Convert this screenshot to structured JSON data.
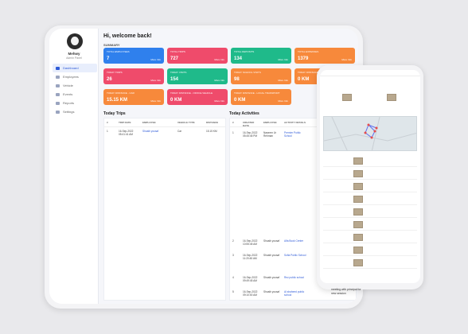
{
  "user": {
    "name": "Mehwy",
    "role": "Admin Panel"
  },
  "nav": [
    {
      "label": "Dashboard",
      "active": true
    },
    {
      "label": "Employees",
      "active": false
    },
    {
      "label": "Vehicle",
      "active": false
    },
    {
      "label": "Events",
      "active": false
    },
    {
      "label": "Reports",
      "active": false
    },
    {
      "label": "Settings",
      "active": false
    }
  ],
  "greeting": "Hi, welcome back!",
  "summary_label": "SUMMARY",
  "cards": [
    {
      "label": "TOTAL EMPLOYEES",
      "value": "7",
      "more": "More Info",
      "color": "#2f80ed"
    },
    {
      "label": "TOTAL TRIPS",
      "value": "727",
      "more": "More Info",
      "color": "#ef4b6b"
    },
    {
      "label": "TOTAL DEPOSITS",
      "value": "134",
      "more": "More Info",
      "color": "#1fba8a"
    },
    {
      "label": "TOTAL EXPENSES",
      "value": "1379",
      "more": "More Info",
      "color": "#f7893b"
    },
    {
      "label": "TODAY TRIPS",
      "value": "26",
      "more": "More Info",
      "color": "#ef4b6b"
    },
    {
      "label": "TODAY VISITS",
      "value": "154",
      "more": "More Info",
      "color": "#1fba8a"
    },
    {
      "label": "TODAY SCHOOL VISITS",
      "value": "98",
      "more": "More Info",
      "color": "#f7893b"
    },
    {
      "label": "TODAY DISTANCE",
      "value": "0 KM",
      "more": "More Info",
      "color": "#f7893b"
    },
    {
      "label": "TODAY Distance - Car",
      "value": "15.15 KM",
      "more": "More Info",
      "color": "#f7893b"
    },
    {
      "label": "TODAY Distance - Office Vehicle",
      "value": "0 KM",
      "more": "More Info",
      "color": "#ef4b6b"
    },
    {
      "label": "TODAY Distance - Local Transport",
      "value": "0 KM",
      "more": "More Info",
      "color": "#f7893b"
    }
  ],
  "trips": {
    "title": "Today Trips",
    "headers": [
      "#",
      "TRIP DATE",
      "EMPLOYEE",
      "VEHICLE TYPE",
      "DISTANCE"
    ],
    "rows": [
      [
        "1",
        "16-Sep-2022 05:41:41 AM",
        "Shoaib yousaf",
        "Car",
        "15.15 KM"
      ]
    ]
  },
  "activities": {
    "title": "Today Activities",
    "headers": [
      "#",
      "CREATED DATE",
      "EMPLOYEE",
      "ACTIVITY DETAILS"
    ],
    "rows": [
      [
        "1",
        "16-Sep-2022 05:45:45 PM",
        "Naseem Ur Rehman",
        "Premier Public School"
      ],
      [
        "2",
        "16-Sep-2022 10:55:45 AM",
        "Shoaib yousaf",
        "Alfa Book Center"
      ],
      [
        "3",
        "16-Sep-2022 11:20:45 AM",
        "Shoaib yousaf",
        "Sofia Public School"
      ],
      [
        "4",
        "16-Sep-2022 09:49:45 AM",
        "Shoaib yousaf",
        "Rez public school"
      ],
      [
        "5",
        "16-Sep-2022 09:10:00 AM",
        "Shoaib yousaf",
        "Al shaheed public school"
      ]
    ],
    "note": "meeting with principal for new session"
  }
}
